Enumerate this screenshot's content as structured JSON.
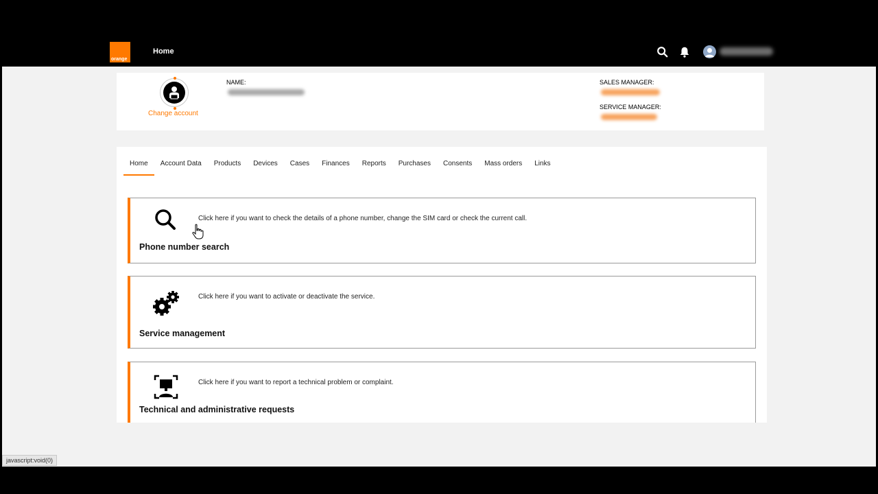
{
  "header": {
    "logo_text": "orange",
    "nav_home": "Home",
    "icons": [
      "search-icon",
      "bell-icon",
      "user-avatar-icon"
    ]
  },
  "account": {
    "change_account_label": "Change account",
    "name_label": "NAME:",
    "sales_manager_label": "SALES MANAGER:",
    "service_manager_label": "SERVICE MANAGER:"
  },
  "tabs": [
    {
      "label": "Home",
      "active": true
    },
    {
      "label": "Account Data"
    },
    {
      "label": "Products"
    },
    {
      "label": "Devices"
    },
    {
      "label": "Cases"
    },
    {
      "label": "Finances"
    },
    {
      "label": "Reports"
    },
    {
      "label": "Purchases"
    },
    {
      "label": "Consents"
    },
    {
      "label": "Mass orders"
    },
    {
      "label": "Links"
    }
  ],
  "actions": [
    {
      "title": "Phone number search",
      "description": "Click here if you want to check the details of a phone number, change the SIM card or check the current call.",
      "icon": "magnifier-icon"
    },
    {
      "title": "Service management",
      "description": "Click here if you want to activate or deactivate the service.",
      "icon": "gears-icon"
    },
    {
      "title": "Technical and administrative requests",
      "description": "Click here if you want to report a technical problem or complaint.",
      "icon": "support-request-icon"
    }
  ],
  "status_bar": "javascript:void(0)",
  "colors": {
    "accent": "#ff7900",
    "topbar": "#000000",
    "background": "#f2f2f2"
  }
}
